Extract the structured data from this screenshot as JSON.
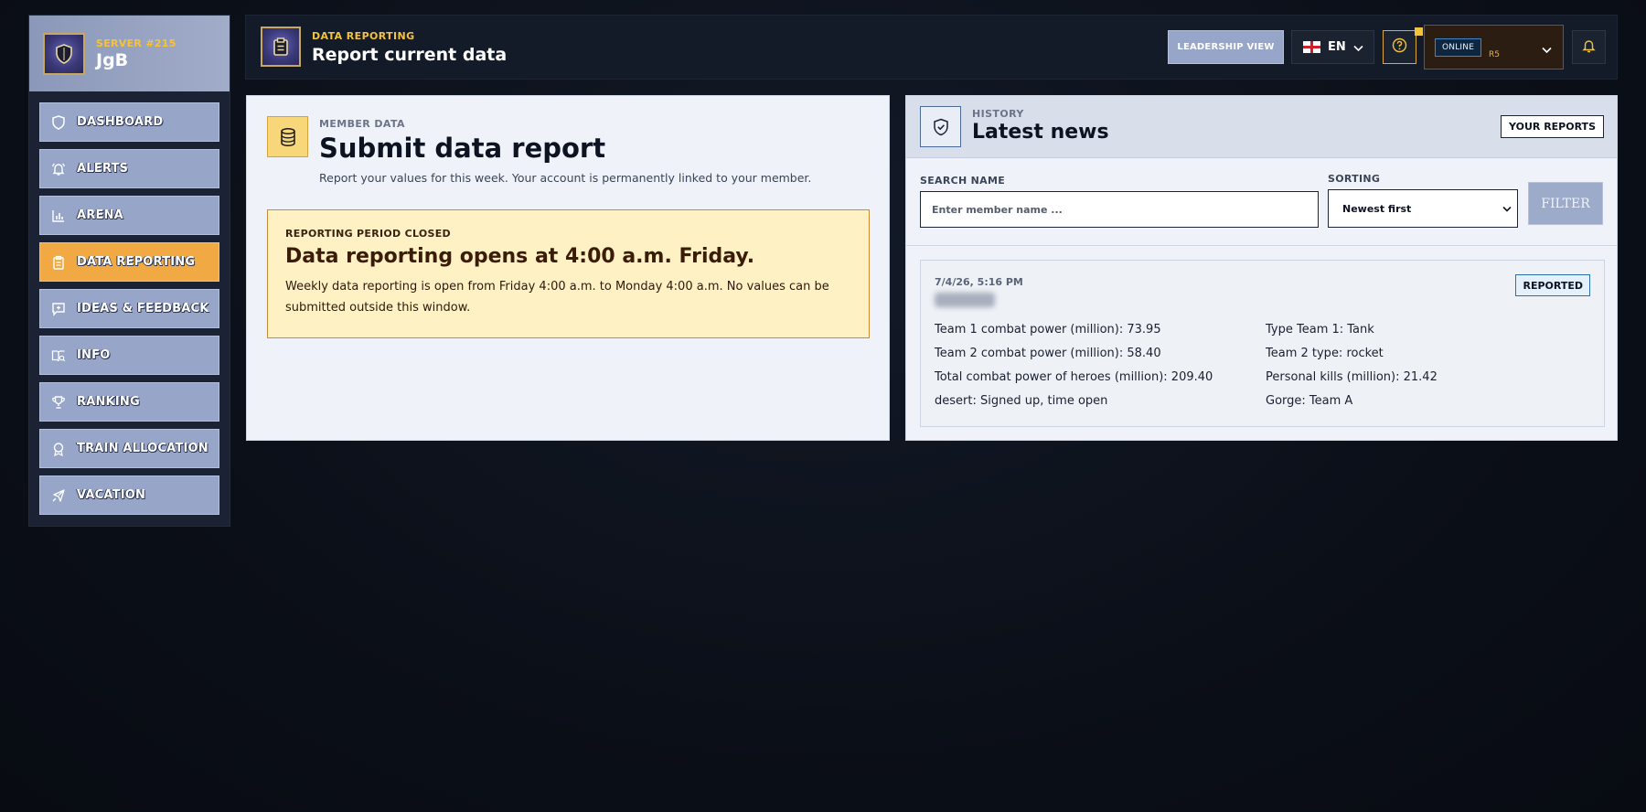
{
  "brand": {
    "server": "SERVER #215",
    "name": "JgB"
  },
  "sidebar": {
    "items": [
      {
        "label": "DASHBOARD",
        "icon": "shield-icon",
        "active": false
      },
      {
        "label": "ALERTS",
        "icon": "bell-ring-icon",
        "active": false
      },
      {
        "label": "ARENA",
        "icon": "bar-chart-icon",
        "active": false
      },
      {
        "label": "DATA REPORTING",
        "icon": "clipboard-icon",
        "active": true
      },
      {
        "label": "IDEAS & FEEDBACK",
        "icon": "message-plus-icon",
        "active": false
      },
      {
        "label": "INFO",
        "icon": "book-open-icon",
        "active": false
      },
      {
        "label": "RANKING",
        "icon": "trophy-icon",
        "active": false
      },
      {
        "label": "TRAIN ALLOCATION",
        "icon": "medal-icon",
        "active": false
      },
      {
        "label": "VACATION",
        "icon": "plane-icon",
        "active": false
      }
    ]
  },
  "topbar": {
    "eyebrow": "DATA REPORTING",
    "title": "Report current data",
    "leadership_label": "LEADERSHIP VIEW",
    "language": "EN",
    "status": "ONLINE",
    "rank": "R5"
  },
  "member_card": {
    "eyebrow": "MEMBER DATA",
    "title": "Submit data report",
    "subtitle": "Report your values for this week. Your account is permanently linked to your member.",
    "notice": {
      "eyebrow": "REPORTING PERIOD CLOSED",
      "title": "Data reporting opens at 4:00 a.m. Friday.",
      "text": "Weekly data reporting is open from Friday 4:00 a.m. to Monday 4:00 a.m. No values can be submitted outside this window."
    }
  },
  "history_card": {
    "eyebrow": "HISTORY",
    "title": "Latest news",
    "your_reports_label": "YOUR REPORTS",
    "search": {
      "label": "SEARCH NAME",
      "placeholder": "Enter member name ...",
      "value": ""
    },
    "sorting": {
      "label": "SORTING",
      "selected": "Newest first"
    },
    "filter_label": "FILTER",
    "report": {
      "date": "7/4/26, 5:16 PM",
      "status": "REPORTED",
      "fields": [
        "Team 1 combat power (million): 73.95",
        "Type Team 1: Tank",
        "Team 2 combat power (million): 58.40",
        "Team 2 type: rocket",
        "Total combat power of heroes (million): 209.40",
        "Personal kills (million): 21.42",
        "desert: Signed up, time open",
        "Gorge: Team A"
      ]
    }
  },
  "colors": {
    "accent": "#f5c33b",
    "active_nav": "#f0a943",
    "nav": "#97a5c9",
    "notice_bg": "#fef1c4",
    "online": "#3e87c9"
  }
}
